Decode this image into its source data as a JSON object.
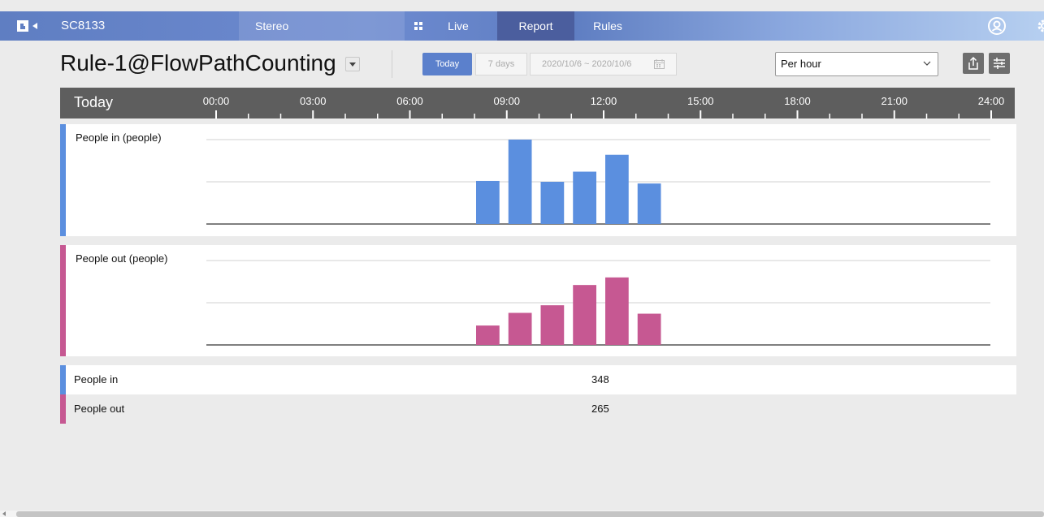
{
  "header": {
    "device_name": "SC8133",
    "app_tab": "Stereo",
    "nav": {
      "live": "Live",
      "report": "Report",
      "rules": "Rules"
    },
    "active_nav": "Report"
  },
  "toolbar": {
    "rule_name": "Rule-1@FlowPathCounting",
    "today_label": "Today",
    "seven_days_label": "7 days",
    "date_range": "2020/10/6 ~ 2020/10/6",
    "interval_selected": "Per hour"
  },
  "timeline": {
    "label": "Today",
    "ticks": [
      "00:00",
      "03:00",
      "06:00",
      "09:00",
      "12:00",
      "15:00",
      "18:00",
      "21:00",
      "24:00"
    ]
  },
  "chart_data": [
    {
      "type": "bar",
      "title": "People in (people)",
      "color": "#5b8fdf",
      "accent": "#5b8fdf",
      "x_hours": [
        8,
        9,
        10,
        11,
        12,
        13
      ],
      "values": [
        51,
        100,
        50,
        62,
        82,
        48
      ],
      "ylim": [
        0,
        100
      ],
      "grid": true
    },
    {
      "type": "bar",
      "title": "People out (people)",
      "color": "#c65892",
      "accent": "#c65892",
      "x_hours": [
        8,
        9,
        10,
        11,
        12,
        13
      ],
      "values": [
        23,
        38,
        47,
        71,
        80,
        37
      ],
      "ylim": [
        0,
        100
      ],
      "grid": true
    }
  ],
  "summary": [
    {
      "label": "People in",
      "value": "348",
      "accent": "#5b8fdf"
    },
    {
      "label": "People out",
      "value": "265",
      "accent": "#c65892"
    }
  ]
}
